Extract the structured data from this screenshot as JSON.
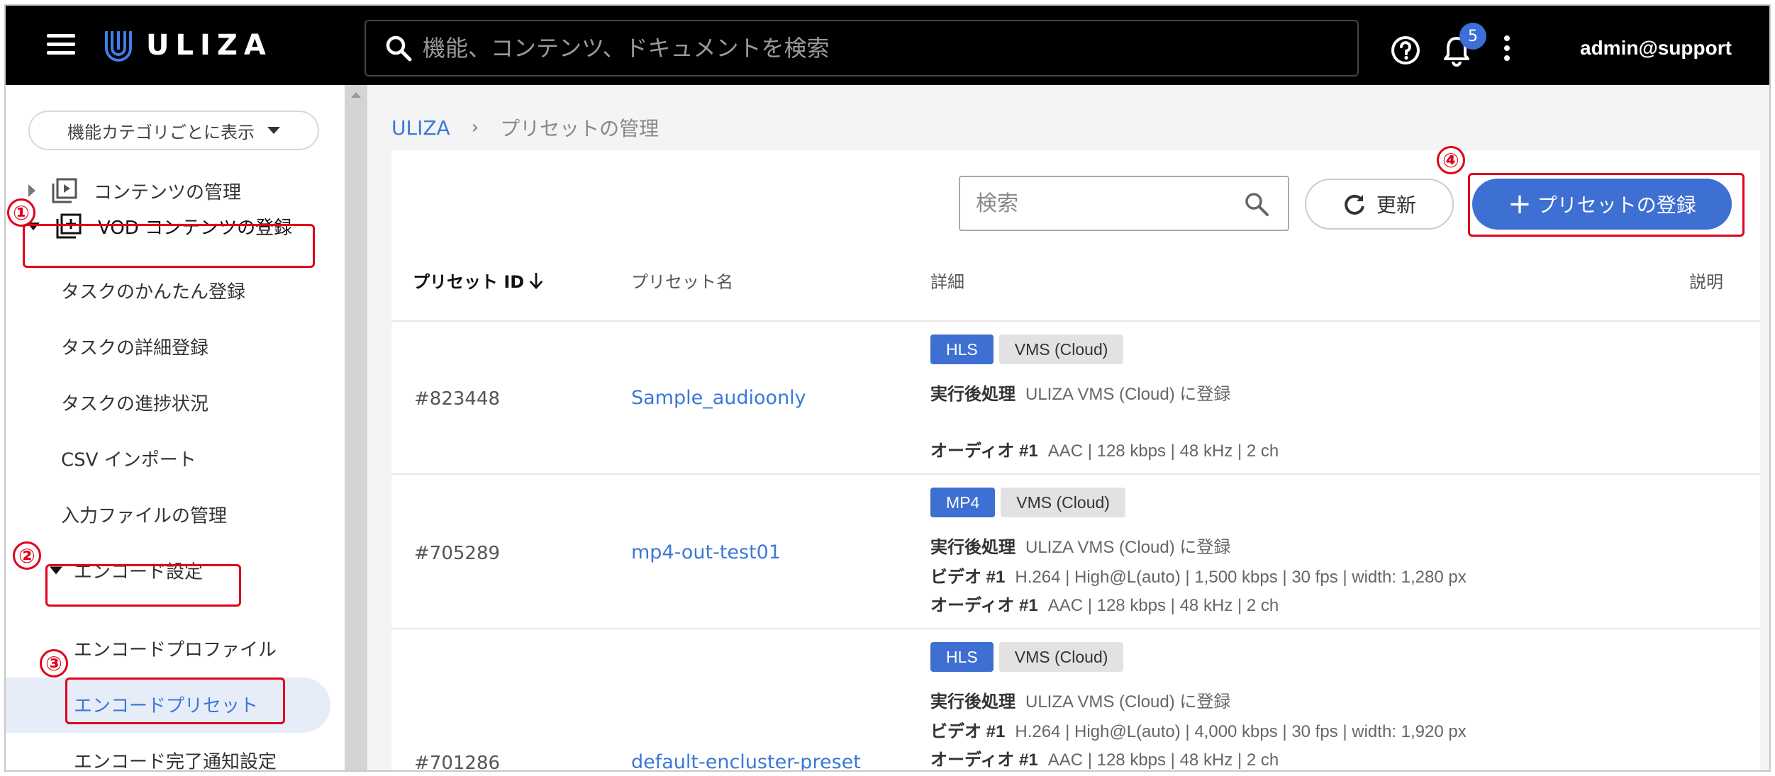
{
  "topbar": {
    "brand": "ULIZA",
    "search_placeholder": "機能、コンテンツ、ドキュメントを検索",
    "notification_count": "5",
    "user": "admin@support",
    "icons": [
      "menu-icon",
      "uliza-logo",
      "search-icon",
      "help-icon",
      "bell-icon",
      "more-vert-icon"
    ]
  },
  "sidebar": {
    "category_select": "機能カテゴリごとに表示",
    "items": [
      {
        "label": "コンテンツの管理"
      },
      {
        "label": "VOD コンテンツの登録"
      },
      {
        "label": "タスクのかんたん登録"
      },
      {
        "label": "タスクの詳細登録"
      },
      {
        "label": "タスクの進捗状況"
      },
      {
        "label": "CSV インポート"
      },
      {
        "label": "入力ファイルの管理"
      },
      {
        "label": "エンコード設定"
      },
      {
        "label": "エンコードプロファイル"
      },
      {
        "label": "エンコードプリセット"
      },
      {
        "label": "エンコード完了通知設定"
      }
    ],
    "selected": "エンコードプリセット"
  },
  "annotations": [
    "①",
    "②",
    "③",
    "④"
  ],
  "breadcrumb": {
    "root": "ULIZA",
    "separator": "›",
    "current": "プリセットの管理"
  },
  "toolbar": {
    "search_placeholder": "検索",
    "refresh_label": "更新",
    "register_label": "プリセットの登録"
  },
  "table": {
    "headers": {
      "id": "プリセット ID",
      "name": "プリセット名",
      "detail": "詳細",
      "description": "説明"
    },
    "rows": [
      {
        "id": "#823448",
        "name": "Sample_audioonly",
        "tags": [
          "HLS",
          "VMS (Cloud)"
        ],
        "post_label": "実行後処理",
        "post_value": "ULIZA VMS (Cloud) に登録",
        "video_label": "",
        "video_value": "",
        "audio_label": "オーディオ #1",
        "audio_value": "AAC | 128 kbps | 48 kHz | 2 ch"
      },
      {
        "id": "#705289",
        "name": "mp4-out-test01",
        "tags": [
          "MP4",
          "VMS (Cloud)"
        ],
        "post_label": "実行後処理",
        "post_value": "ULIZA VMS (Cloud) に登録",
        "video_label": "ビデオ #1",
        "video_value": "H.264 | High@L(auto) | 1,500 kbps | 30 fps | width: 1,280 px",
        "audio_label": "オーディオ #1",
        "audio_value": "AAC | 128 kbps | 48 kHz | 2 ch"
      },
      {
        "id": "#701286",
        "name": "default-encluster-preset",
        "tags": [
          "HLS",
          "VMS (Cloud)"
        ],
        "post_label": "実行後処理",
        "post_value": "ULIZA VMS (Cloud) に登録",
        "video_label": "ビデオ #1",
        "video_value": "H.264 | High@L(auto) | 4,000 kbps | 30 fps | width: 1,920 px",
        "audio_label": "オーディオ #1",
        "audio_value": "AAC | 128 kbps | 48 kHz | 2 ch"
      }
    ]
  },
  "colors": {
    "topbar_bg": "#000000",
    "accent": "#3e6fd2",
    "link": "#3b78d8",
    "annotation": "#e0001a",
    "selected_bg": "#e6edf9"
  }
}
